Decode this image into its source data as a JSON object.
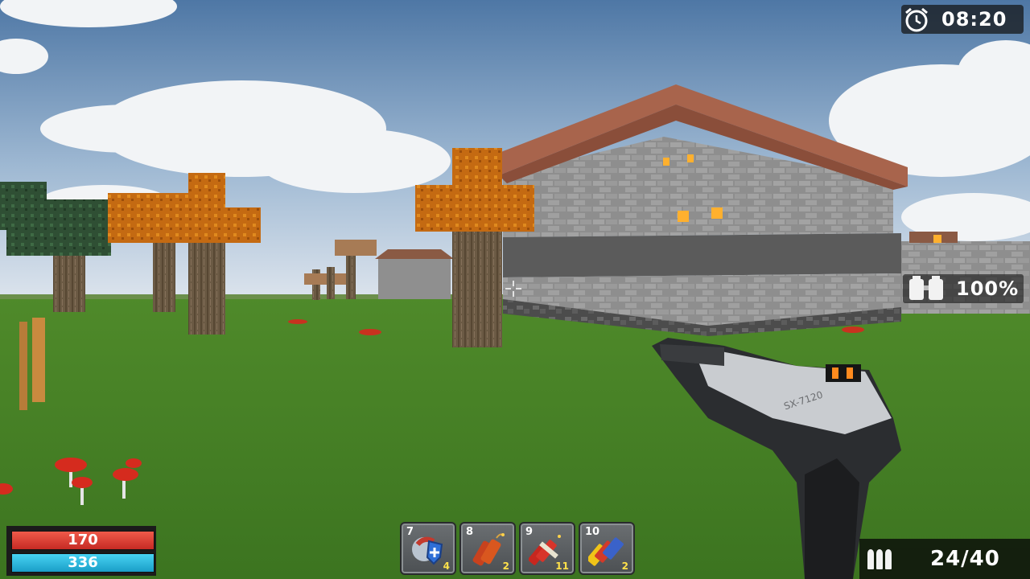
{
  "hud": {
    "clock": {
      "time": "08:20",
      "icon": "alarm-clock-icon"
    },
    "armor": {
      "value": "100%",
      "icon": "armor-icon"
    },
    "health": {
      "value": "170",
      "fill": 1.0,
      "color": "#d9362c"
    },
    "stamina": {
      "value": "336",
      "fill": 1.0,
      "color": "#2cb6de"
    },
    "ammo": {
      "value": "24/40",
      "icon": "bullets-icon"
    },
    "weapon": {
      "model_text": "SX-7120"
    }
  },
  "hotbar": [
    {
      "slot": "7",
      "count": "4",
      "icon": "shield-potion-icon"
    },
    {
      "slot": "8",
      "count": "2",
      "icon": "dynamite-icon"
    },
    {
      "slot": "9",
      "count": "11",
      "icon": "dynamite-bundle-icon"
    },
    {
      "slot": "10",
      "count": "2",
      "icon": "batteries-icon"
    }
  ]
}
